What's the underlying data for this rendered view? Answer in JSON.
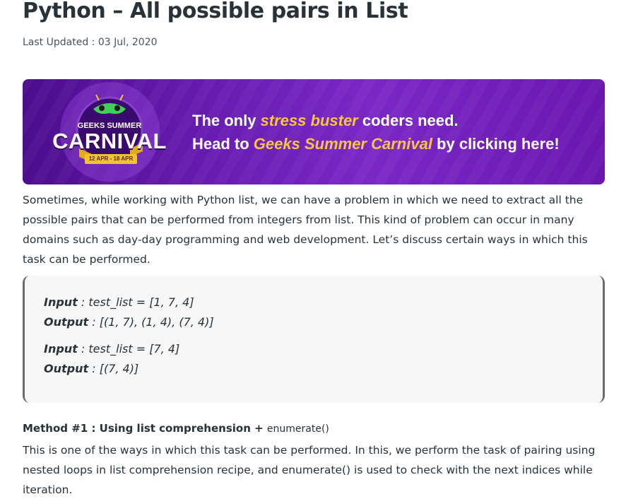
{
  "article": {
    "title": "Python – All possible pairs in List",
    "updated": "Last Updated : 03 Jul, 2020"
  },
  "banner": {
    "logo_top": "GEEKS SUMMER",
    "logo_main": "CARNIVAL",
    "logo_dates": "12 APR - 18 APR",
    "line1_pre": "The only ",
    "line1_highlight": "stress buster",
    "line1_post": " coders need.",
    "line2_pre": "Head to ",
    "line2_highlight": "Geeks Summer Carnival",
    "line2_post": " by clicking here!",
    "colors": {
      "accent": "#f7c542",
      "background": "#6a1db3"
    }
  },
  "intro": "Sometimes, while working with Python list, we can have a problem in which we need to extract all the possible pairs that can be performed from integers from list. This kind of problem can occur in many domains such as day-day programming and web development. Let’s discuss certain ways in which this task can be performed.",
  "examples": [
    {
      "input_label": "Input",
      "input_value": " : test_list = [1, 7, 4]",
      "output_label": "Output",
      "output_value": " : [(1, 7), (1, 4), (7, 4)]"
    },
    {
      "input_label": "Input",
      "input_value": " : test_list = [7, 4]",
      "output_label": "Output",
      "output_value": " : [(7, 4)]"
    }
  ],
  "method1": {
    "heading": "Method #1 : Using list comprehension + ",
    "heading_fn": "enumerate()",
    "description": "This is one of the ways in which this task can be performed. In this, we perform the task of pairing using nested loops in list comprehension recipe, and enumerate() is used to check with the next indices while iteration."
  }
}
